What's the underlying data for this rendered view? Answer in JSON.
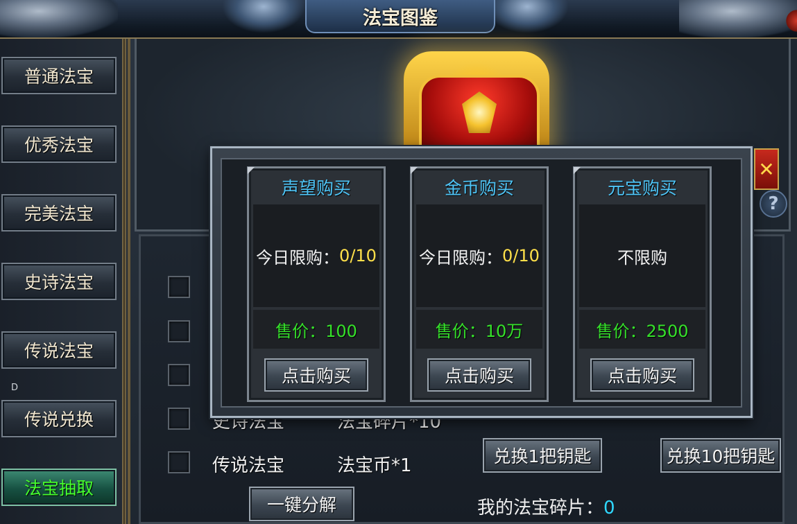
{
  "window": {
    "title": "法宝图鉴"
  },
  "sidebar": {
    "items": [
      {
        "label": "普通法宝",
        "active": false
      },
      {
        "label": "优秀法宝",
        "active": false
      },
      {
        "label": "完美法宝",
        "active": false
      },
      {
        "label": "史诗法宝",
        "active": false
      },
      {
        "label": "传说法宝",
        "active": false
      },
      {
        "label": "传说兑换",
        "active": false
      },
      {
        "label": "法宝抽取",
        "active": true
      }
    ],
    "note": "D"
  },
  "list": {
    "rows": [
      {
        "name": "史诗法宝",
        "reward": "法宝碎片*10"
      },
      {
        "name": "传说法宝",
        "reward": "法宝币*1"
      }
    ]
  },
  "actions": {
    "decompose_label": "一键分解",
    "exchange1_label": "兑换1把钥匙",
    "exchange10_label": "兑换10把钥匙",
    "shards_label": "我的法宝碎片：",
    "shards_value": "0"
  },
  "help": {
    "icon": "question-icon",
    "glyph": "?"
  },
  "popup": {
    "close_glyph": "✕",
    "cards": [
      {
        "title": "声望购买",
        "limit_label": "今日限购：",
        "limit_value": "0/10",
        "price": "售价：100",
        "button": "点击购买"
      },
      {
        "title": "金币购买",
        "limit_label": "今日限购：",
        "limit_value": "0/10",
        "price": "售价：10万",
        "button": "点击购买"
      },
      {
        "title": "元宝购买",
        "limit_label": "不限购",
        "limit_value": "",
        "price": "售价：2500",
        "button": "点击购买"
      }
    ]
  },
  "colors": {
    "card_title": "#4ec4f6",
    "price_green": "#35e02a",
    "limit_yellow": "#ffe04a",
    "active_nav_text": "#46ff2e",
    "shards_cyan": "#2fd8ff"
  }
}
